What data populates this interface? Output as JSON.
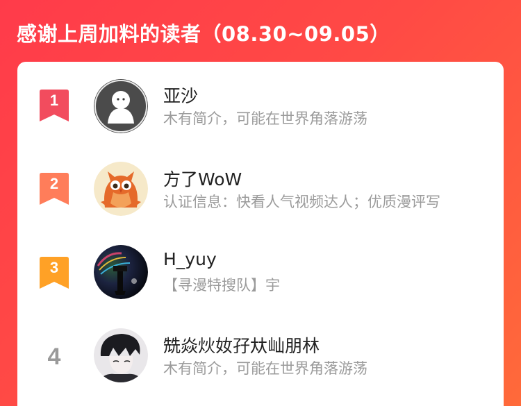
{
  "header": {
    "title": "感谢上周加料的读者（08.30~09.05）"
  },
  "colors": {
    "rank1": "#f24c5e",
    "rank2": "#ff7d5a",
    "rank3": "#ffa126",
    "rank4_text": "#9a9a9a",
    "accent": "#ff4048"
  },
  "readers": [
    {
      "rank": "1",
      "name": "亚沙",
      "desc": "木有简介，可能在世界角落游荡",
      "avatar_icon": "default-ghost-avatar"
    },
    {
      "rank": "2",
      "name": "方了WoW",
      "desc": "认证信息：快看人气视频达人；优质漫评写",
      "avatar_icon": "owl-avatar"
    },
    {
      "rank": "3",
      "name": "H_yuy",
      "desc": "【寻漫特搜队】宇",
      "avatar_icon": "dark-scene-avatar"
    },
    {
      "rank": "4",
      "name": "兟焱炏奻孖夶屾朋林",
      "desc": "木有简介，可能在世界角落游荡",
      "avatar_icon": "anime-boy-avatar"
    }
  ]
}
